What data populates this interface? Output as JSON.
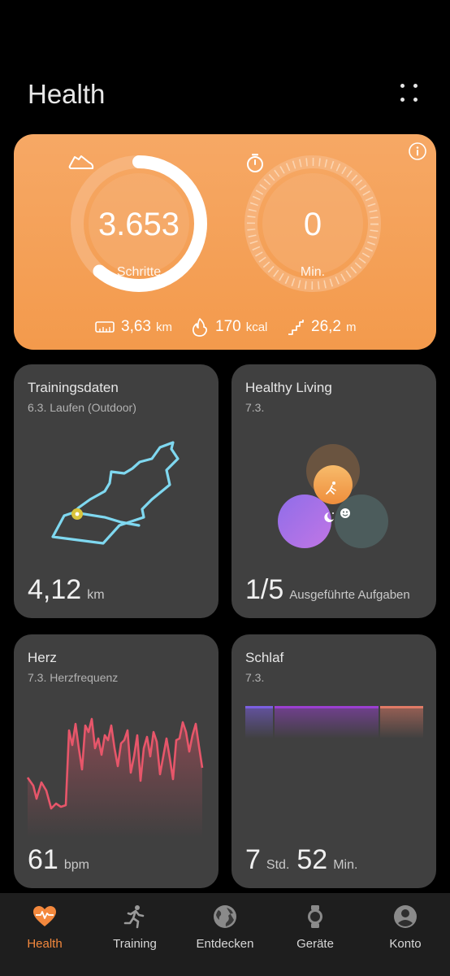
{
  "header": {
    "title": "Health"
  },
  "activity": {
    "steps_value": "3.653",
    "steps_unit": "Schritte",
    "steps_progress": 0.61,
    "minutes_value": "0",
    "minutes_unit": "Min.",
    "distance_value": "3,63",
    "distance_unit": "km",
    "calories_value": "170",
    "calories_unit": "kcal",
    "floors_value": "26,2",
    "floors_unit": "m"
  },
  "tiles": {
    "training": {
      "title": "Trainingsdaten",
      "subtitle": "6.3.  Laufen (Outdoor)",
      "value": "4,12",
      "unit": "km"
    },
    "healthy": {
      "title": "Healthy Living",
      "subtitle": "7.3.",
      "value": "1/5",
      "unit": "Ausgeführte Aufgaben"
    },
    "heart": {
      "title": "Herz",
      "subtitle": "7.3.  Herzfrequenz",
      "value": "61",
      "unit": "bpm"
    },
    "sleep": {
      "title": "Schlaf",
      "subtitle": "7.3.",
      "hours": "7",
      "hours_unit": "Std.",
      "minutes": "52",
      "minutes_unit": "Min."
    }
  },
  "nav": {
    "items": [
      {
        "label": "Health",
        "icon": "heart-pulse-icon"
      },
      {
        "label": "Training",
        "icon": "runner-icon"
      },
      {
        "label": "Entdecken",
        "icon": "globe-icon"
      },
      {
        "label": "Geräte",
        "icon": "watch-icon"
      },
      {
        "label": "Konto",
        "icon": "account-icon"
      }
    ]
  },
  "colors": {
    "accent": "#f3883d",
    "card_orange": "#f39a4c",
    "tile_bg": "#404040",
    "route": "#7fd8f0",
    "heart_line": "#e7566a",
    "sleep_deep": "#9b3fd1",
    "sleep_light": "#7b5fe0",
    "sleep_awake": "#e07a66"
  }
}
